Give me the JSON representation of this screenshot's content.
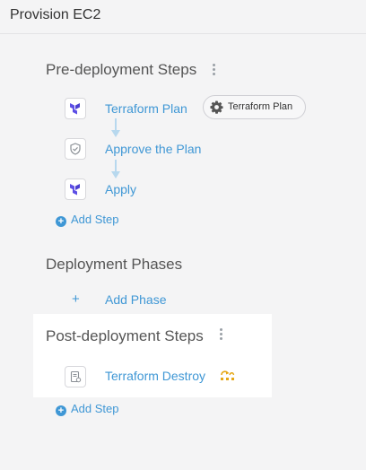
{
  "window": {
    "title": "Provision EC2"
  },
  "pre_deployment": {
    "title": "Pre-deployment Steps",
    "steps": [
      {
        "label": "Terraform Plan",
        "icon": "terraform-icon"
      },
      {
        "label": "Approve the Plan",
        "icon": "approval-icon"
      },
      {
        "label": "Apply",
        "icon": "terraform-icon"
      }
    ],
    "badge": {
      "label": "Terraform Plan",
      "icon": "gear-icon"
    },
    "add_step_label": "Add Step"
  },
  "deployment_phases": {
    "title": "Deployment Phases",
    "add_phase_label": "Add Phase"
  },
  "post_deployment": {
    "title": "Post-deployment Steps",
    "steps": [
      {
        "label": "Terraform Destroy",
        "icon": "script-icon",
        "status_icon": "rollback-icon"
      }
    ],
    "add_step_label": "Add Step"
  },
  "colors": {
    "accent": "#3f97d5",
    "terraform": "#5c4ee5",
    "rollback": "#e6a817",
    "connector": "#b7d8ee"
  }
}
